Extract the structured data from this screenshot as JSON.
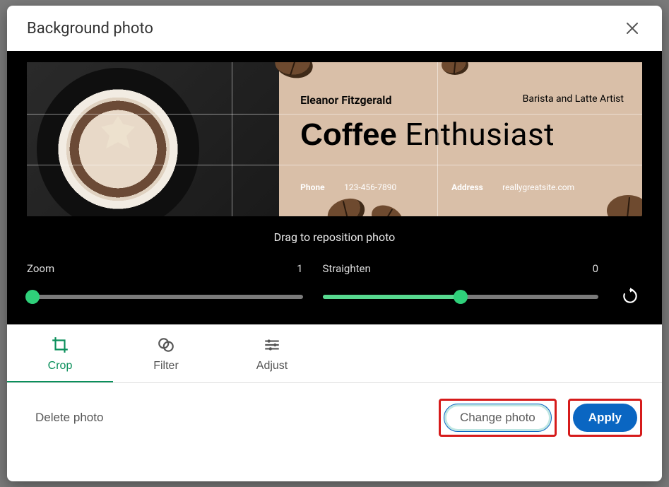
{
  "modal": {
    "title": "Background photo",
    "hint": "Drag to reposition photo"
  },
  "banner": {
    "name": "Eleanor Fitzgerald",
    "role": "Barista and Latte Artist",
    "headline_bold": "Coffee",
    "headline_light": "Enthusiast",
    "phone_label": "Phone",
    "phone_value": "123-456-7890",
    "address_label": "Address",
    "address_value": "reallygreatsite.com"
  },
  "controls": {
    "zoom": {
      "label": "Zoom",
      "value": "1",
      "percent": 0
    },
    "straighten": {
      "label": "Straighten",
      "value": "0",
      "percent": 50
    }
  },
  "tabs": {
    "crop": "Crop",
    "filter": "Filter",
    "adjust": "Adjust",
    "active": "crop"
  },
  "footer": {
    "delete": "Delete photo",
    "change": "Change photo",
    "apply": "Apply"
  }
}
